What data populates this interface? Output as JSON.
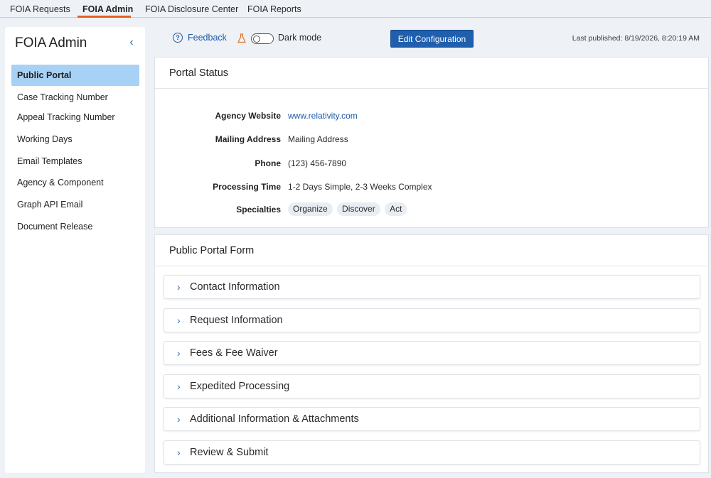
{
  "topnav": {
    "tabs": [
      {
        "label": "FOIA Requests"
      },
      {
        "label": "FOIA Admin"
      },
      {
        "label": "FOIA Disclosure Center"
      },
      {
        "label": "FOIA Reports"
      }
    ]
  },
  "sidebar": {
    "title": "FOIA Admin",
    "collapse_icon": "chevron-left-icon",
    "items": [
      {
        "label": "Public Portal",
        "active": true
      },
      {
        "label": "Case Tracking Number"
      },
      {
        "label": "Appeal Tracking Number"
      },
      {
        "label": "Working Days"
      },
      {
        "label": "Email Templates"
      },
      {
        "label": "Agency & Component"
      },
      {
        "label": "Graph API Email"
      },
      {
        "label": "Document Release"
      }
    ]
  },
  "toolbar": {
    "feedback_icon": "?",
    "feedback_label": "Feedback",
    "darkmode_label": "Dark mode",
    "edit_label": "Edit Configuration",
    "last_published": "Last published: 8/19/2026, 8:20:19 AM"
  },
  "portal_status": {
    "title": "Portal Status",
    "fields": [
      {
        "label": "Agency Website",
        "value": "www.relativity.com"
      },
      {
        "label": "Mailing Address",
        "value": "Mailing Address"
      },
      {
        "label": "Phone",
        "value": "(123) 456-7890"
      },
      {
        "label": "Processing Time",
        "value": "1-2 Days Simple, 2-3 Weeks Complex"
      },
      {
        "label": "Specialties",
        "chips": [
          "Organize",
          "Discover",
          "Act"
        ]
      }
    ]
  },
  "portal_form": {
    "title": "Public Portal Form",
    "sections": [
      {
        "label": "Contact Information"
      },
      {
        "label": "Request Information"
      },
      {
        "label": "Fees & Fee Waiver"
      },
      {
        "label": "Expedited Processing"
      },
      {
        "label": "Additional Information & Attachments"
      },
      {
        "label": "Review & Submit"
      }
    ]
  },
  "colors": {
    "accent": "#1f5fae",
    "active_tab_underline": "#e55f1e",
    "active_sidebar": "#a8d1f6"
  }
}
